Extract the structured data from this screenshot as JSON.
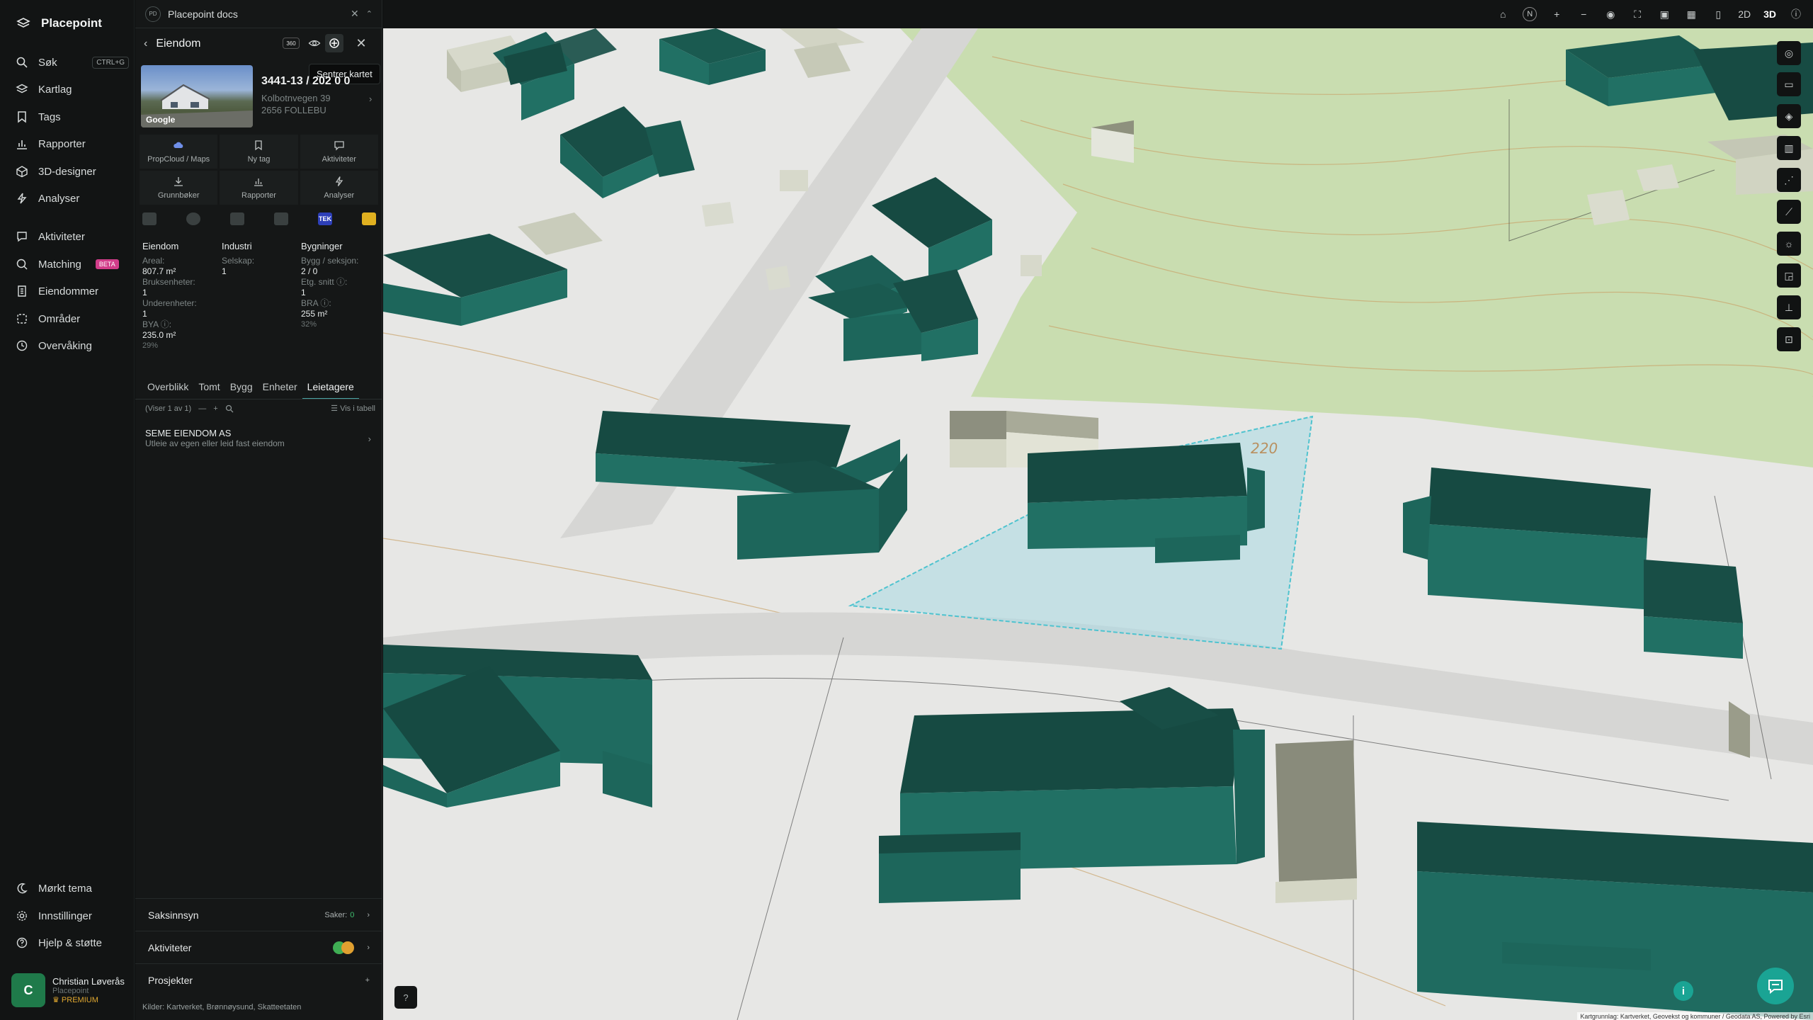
{
  "app": {
    "name": "Placepoint"
  },
  "nav": {
    "items": [
      {
        "label": "Søk",
        "shortcut": "CTRL+G"
      },
      {
        "label": "Kartlag"
      },
      {
        "label": "Tags"
      },
      {
        "label": "Rapporter"
      },
      {
        "label": "3D-designer"
      },
      {
        "label": "Analyser"
      },
      {
        "label": "Aktiviteter"
      },
      {
        "label": "Matching",
        "badge": "BETA"
      },
      {
        "label": "Eiendommer"
      },
      {
        "label": "Områder"
      },
      {
        "label": "Overvåking"
      }
    ],
    "bottom": [
      {
        "label": "Mørkt tema"
      },
      {
        "label": "Innstillinger"
      },
      {
        "label": "Hjelp & støtte"
      }
    ],
    "user": {
      "initial": "C",
      "name": "Christian Løverås",
      "org": "Placepoint",
      "plan": "PREMIUM"
    }
  },
  "panel": {
    "doc_tab": {
      "badge": "PD",
      "title": "Placepoint docs"
    },
    "header": {
      "title": "Eiendom",
      "badge": "360"
    },
    "tooltip": "Sentrer kartet",
    "thumb_label": "Google",
    "property": {
      "id": "3441-13 / 202 0 0",
      "street": "Kolbotnvegen 39",
      "city": "2656 FOLLEBU"
    },
    "actions": [
      {
        "label": "PropCloud / Maps"
      },
      {
        "label": "Ny tag"
      },
      {
        "label": "Aktiviteter"
      },
      {
        "label": "Grunnbøker"
      },
      {
        "label": "Rapporter"
      },
      {
        "label": "Analyser"
      }
    ],
    "source_tek": "TEK",
    "stats": {
      "col1": {
        "heading": "Eiendom",
        "areal_label": "Areal:",
        "areal_value": "807.7 m²",
        "bruks_label": "Bruksenheter:",
        "bruks_value": "1",
        "under_label": "Underenheter:",
        "under_value": "1",
        "bya_label": "BYA ⓘ:",
        "bya_value": "235.0 m²",
        "bya_pct": "29%"
      },
      "col2": {
        "heading": "Industri",
        "selskap_label": "Selskap:",
        "selskap_value": "1"
      },
      "col3": {
        "heading": "Bygninger",
        "bygg_label": "Bygg / seksjon:",
        "bygg_value": "2 / 0",
        "etg_label": "Etg. snitt ⓘ:",
        "etg_value": "1",
        "bra_label": "BRA ⓘ:",
        "bra_value": "255 m²",
        "bra_pct": "32%"
      }
    },
    "tabs": [
      "Overblikk",
      "Tomt",
      "Bygg",
      "Enheter",
      "Leietagere"
    ],
    "counter": "(Viser 1 av 1)",
    "vis_tabell": "Vis i tabell",
    "tenant": {
      "name": "SEME EIENDOM AS",
      "desc": "Utleie av egen eller leid fast eiendom"
    },
    "sections": {
      "saksinnsyn": {
        "label": "Saksinnsyn",
        "count_label": "Saker:",
        "count": "0"
      },
      "aktiviteter": {
        "label": "Aktiviteter"
      },
      "prosjekter": {
        "label": "Prosjekter"
      }
    },
    "kilder": {
      "label": "Kilder:",
      "items": "Kartverket, Brønnøysund, Skatteetaten"
    }
  },
  "map": {
    "compass": "N",
    "mode_2d": "2D",
    "mode_3d": "3D",
    "active_mode": "3D",
    "contour_label": "220",
    "attribution": "Kartgrunnlag: Kartverket, Geovekst og kommuner / Geodata AS, Powered by Esri"
  },
  "colors": {
    "building": "#1e6f66",
    "roof": "#16473f",
    "selection": "#8fd3dc",
    "accent": "#1aa494",
    "terrain_green": "#c8dfb0"
  }
}
